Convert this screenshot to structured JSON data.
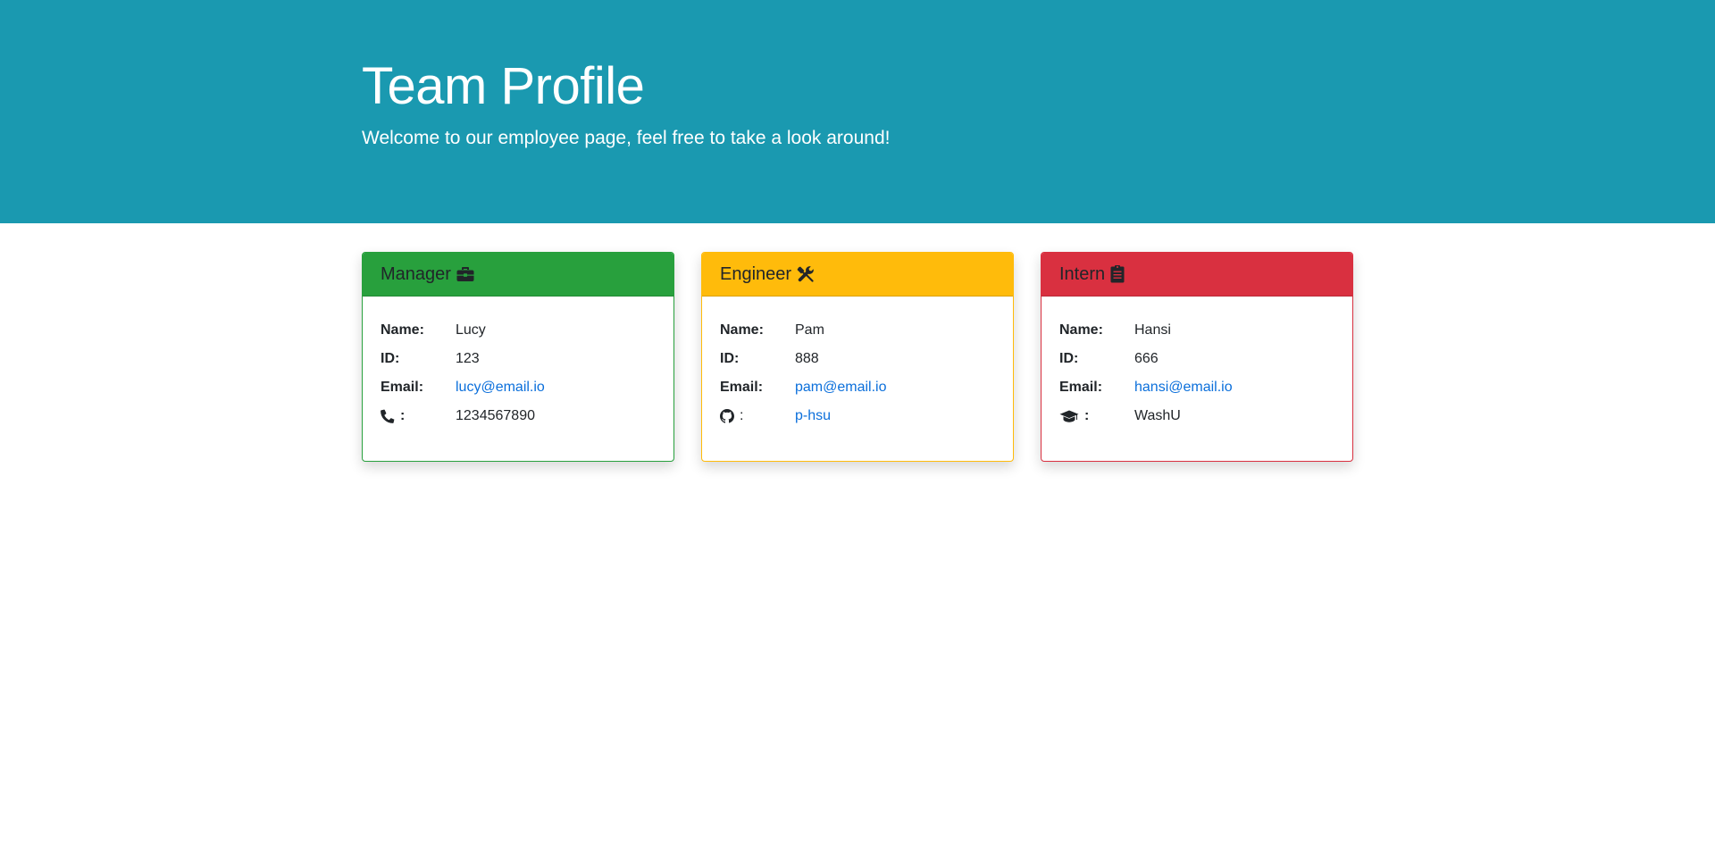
{
  "header": {
    "title": "Team Profile",
    "subtitle": "Welcome to our employee page, feel free to take a look around!"
  },
  "colors": {
    "jumbotron": "#1a99b0",
    "manager": "#28a03d",
    "engineer": "#ffbb0b",
    "intern": "#d93040",
    "link": "#0b6fdb"
  },
  "cards": [
    {
      "role": "Manager",
      "role_icon": "briefcase-icon",
      "name_label": "Name:",
      "name": "Lucy",
      "id_label": "ID:",
      "id": "123",
      "email_label": "Email:",
      "email": "lucy@email.io",
      "extra_icon": "phone-icon",
      "extra_sep": ":",
      "extra": "1234567890"
    },
    {
      "role": "Engineer",
      "role_icon": "tools-icon",
      "name_label": "Name:",
      "name": "Pam",
      "id_label": "ID:",
      "id": "888",
      "email_label": "Email:",
      "email": "pam@email.io",
      "extra_icon": "github-icon",
      "extra_sep": ":",
      "extra": "p-hsu"
    },
    {
      "role": "Intern",
      "role_icon": "clipboard-icon",
      "name_label": "Name:",
      "name": "Hansi",
      "id_label": "ID:",
      "id": "666",
      "email_label": "Email:",
      "email": "hansi@email.io",
      "extra_icon": "graduation-cap-icon",
      "extra_sep": ":",
      "extra": "WashU"
    }
  ]
}
